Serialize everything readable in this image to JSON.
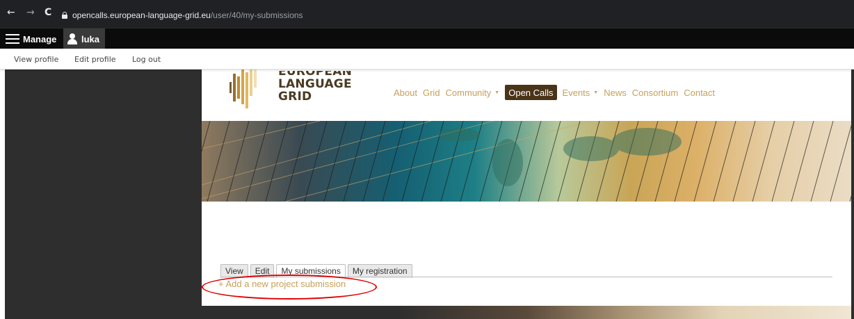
{
  "browser": {
    "back_glyph": "←",
    "forward_glyph": "→",
    "reload_glyph": "C",
    "url_host": "opencalls.european-language-grid.eu",
    "url_path": "/user/40/my-submissions"
  },
  "toolbar": {
    "manage_label": "Manage",
    "user_label": "luka"
  },
  "tray": {
    "view_profile": "View profile",
    "edit_profile": "Edit profile",
    "log_out": "Log out"
  },
  "logo": {
    "line1": "EUROPEAN",
    "line2": "LANGUAGE",
    "line3": "GRID"
  },
  "nav": {
    "items": [
      {
        "label": "About",
        "has_caret": false,
        "active": false
      },
      {
        "label": "Grid",
        "has_caret": false,
        "active": false
      },
      {
        "label": "Community",
        "has_caret": true,
        "active": false
      },
      {
        "label": "Open Calls",
        "has_caret": false,
        "active": true
      },
      {
        "label": "Events",
        "has_caret": true,
        "active": false
      },
      {
        "label": "News",
        "has_caret": false,
        "active": false
      },
      {
        "label": "Consortium",
        "has_caret": false,
        "active": false
      },
      {
        "label": "Contact",
        "has_caret": false,
        "active": false
      }
    ],
    "caret_glyph": "▼"
  },
  "tabs": {
    "items": [
      {
        "label": "View",
        "active": false
      },
      {
        "label": "Edit",
        "active": false
      },
      {
        "label": "My submissions",
        "active": true
      },
      {
        "label": "My registration",
        "active": false
      }
    ]
  },
  "content": {
    "add_link": "+ Add a new project submission"
  },
  "colors": {
    "accent_gold": "#c6a05a",
    "active_nav_bg": "#4a3418",
    "highlight_red": "#e00000",
    "admin_bar": "#0b0b0b",
    "browser_bar": "#202124"
  }
}
